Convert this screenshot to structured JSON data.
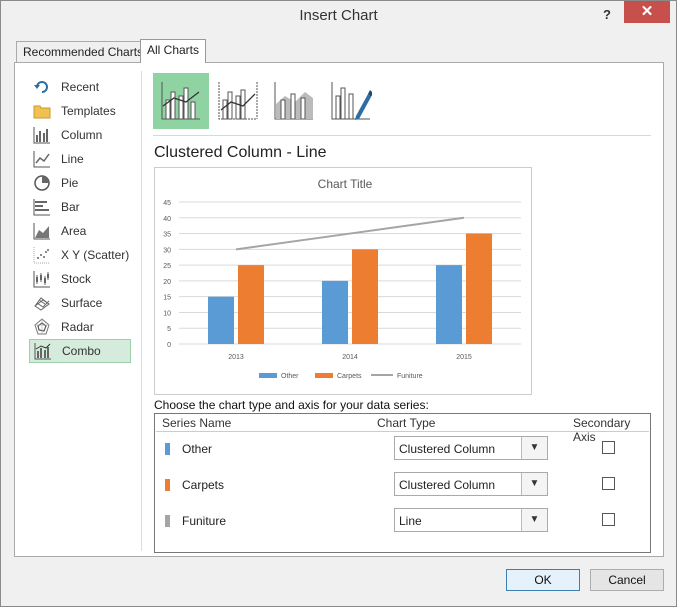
{
  "window": {
    "title": "Insert Chart",
    "help": "?",
    "close": "✕"
  },
  "tabs": [
    {
      "label": "Recommended Charts",
      "active": false
    },
    {
      "label": "All Charts",
      "active": true
    }
  ],
  "sidebar": {
    "items": [
      {
        "label": "Recent",
        "icon": "recent-icon"
      },
      {
        "label": "Templates",
        "icon": "folder-icon"
      },
      {
        "label": "Column",
        "icon": "column-chart-icon"
      },
      {
        "label": "Line",
        "icon": "line-chart-icon"
      },
      {
        "label": "Pie",
        "icon": "pie-chart-icon"
      },
      {
        "label": "Bar",
        "icon": "bar-chart-icon"
      },
      {
        "label": "Area",
        "icon": "area-chart-icon"
      },
      {
        "label": "X Y (Scatter)",
        "icon": "scatter-chart-icon"
      },
      {
        "label": "Stock",
        "icon": "stock-chart-icon"
      },
      {
        "label": "Surface",
        "icon": "surface-chart-icon"
      },
      {
        "label": "Radar",
        "icon": "radar-chart-icon"
      },
      {
        "label": "Combo",
        "icon": "combo-chart-icon",
        "selected": true
      }
    ]
  },
  "subtypes": [
    {
      "icon": "clustered-column-line-icon",
      "selected": true
    },
    {
      "icon": "clustered-column-line-secondary-axis-icon",
      "selected": false
    },
    {
      "icon": "stacked-area-clustered-column-icon",
      "selected": false
    },
    {
      "icon": "custom-combination-icon",
      "selected": false
    }
  ],
  "main": {
    "chart_heading": "Clustered Column - Line",
    "choose_label": "Choose the chart type and axis for your data series:"
  },
  "colors": {
    "other": "#5b9bd5",
    "carpets": "#ed7d31",
    "funiture": "#a5a5a5",
    "selected_green": "#8fd3a2"
  },
  "chart_data": {
    "type": "bar",
    "title": "Chart Title",
    "categories": [
      "2013",
      "2014",
      "2015"
    ],
    "series": [
      {
        "name": "Other",
        "type": "bar",
        "values": [
          15,
          20,
          25
        ],
        "color": "#5b9bd5"
      },
      {
        "name": "Carpets",
        "type": "bar",
        "values": [
          25,
          30,
          35
        ],
        "color": "#ed7d31"
      },
      {
        "name": "Funiture",
        "type": "line",
        "values": [
          30,
          35,
          40
        ],
        "color": "#a5a5a5"
      }
    ],
    "ylim": [
      0,
      45
    ],
    "yticks": [
      0,
      5,
      10,
      15,
      20,
      25,
      30,
      35,
      40,
      45
    ],
    "grid": true,
    "legend": "bottom"
  },
  "series_table": {
    "headers": {
      "name": "Series Name",
      "type": "Chart Type",
      "axis": "Secondary Axis"
    },
    "rows": [
      {
        "name": "Other",
        "chart_type": "Clustered Column",
        "secondary": false
      },
      {
        "name": "Carpets",
        "chart_type": "Clustered Column",
        "secondary": false
      },
      {
        "name": "Funiture",
        "chart_type": "Line",
        "secondary": false
      }
    ]
  },
  "buttons": {
    "ok": "OK",
    "cancel": "Cancel"
  }
}
